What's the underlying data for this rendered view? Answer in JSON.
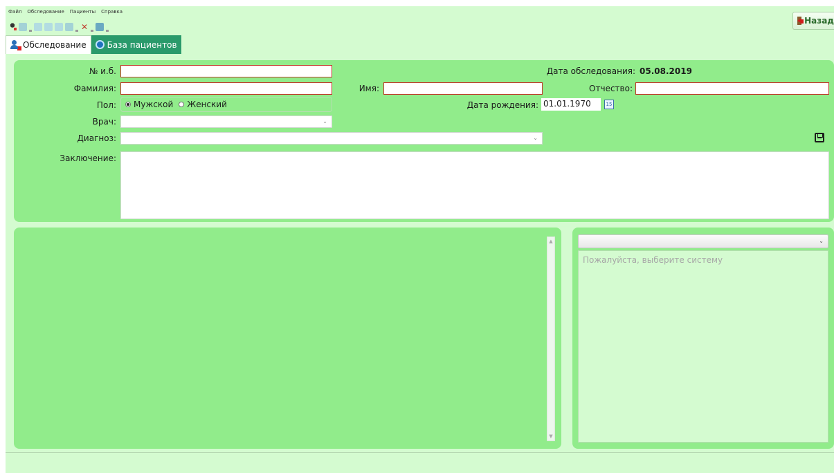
{
  "menu": {
    "items": [
      "Файл",
      "Обследование",
      "Пациенты",
      "Справка"
    ]
  },
  "toolbar": {
    "icons": [
      "user-icon",
      "back-arrow-icon",
      "doc-icon",
      "doc-icon",
      "doc-delete-icon",
      "save-doc-icon",
      "cut-icon",
      "print-icon"
    ]
  },
  "back_button": {
    "label": "Назад"
  },
  "tabs": [
    {
      "label": "Обследование",
      "active": true
    },
    {
      "label": "База пациентов",
      "active": false
    }
  ],
  "form": {
    "record_no_label": "№ и.б.",
    "record_no_value": "",
    "surname_label": "Фамилия:",
    "surname_value": "",
    "name_label": "Имя:",
    "name_value": "",
    "patronymic_label": "Отчество:",
    "patronymic_value": "",
    "gender_label": "Пол:",
    "gender_male": "Мужской",
    "gender_female": "Женский",
    "gender_selected": "Мужской",
    "doctor_label": "Врач:",
    "doctor_value": "",
    "diagnosis_label": "Диагноз:",
    "diagnosis_value": "",
    "conclusion_label": "Заключение:",
    "conclusion_value": "",
    "exam_date_label": "Дата обследования:",
    "exam_date_value": "05.08.2019",
    "birth_date_label": "Дата рождения:",
    "birth_date_value": "01.01.1970",
    "calendar_icon_text": "15"
  },
  "system_panel": {
    "select_value": "",
    "placeholder": "Пожалуйста, выберите систему"
  },
  "colors": {
    "panel_green": "#91ec8b",
    "background_green": "#d4fbd0",
    "required_border": "#c0392b",
    "inactive_tab": "#2a9a6b"
  }
}
